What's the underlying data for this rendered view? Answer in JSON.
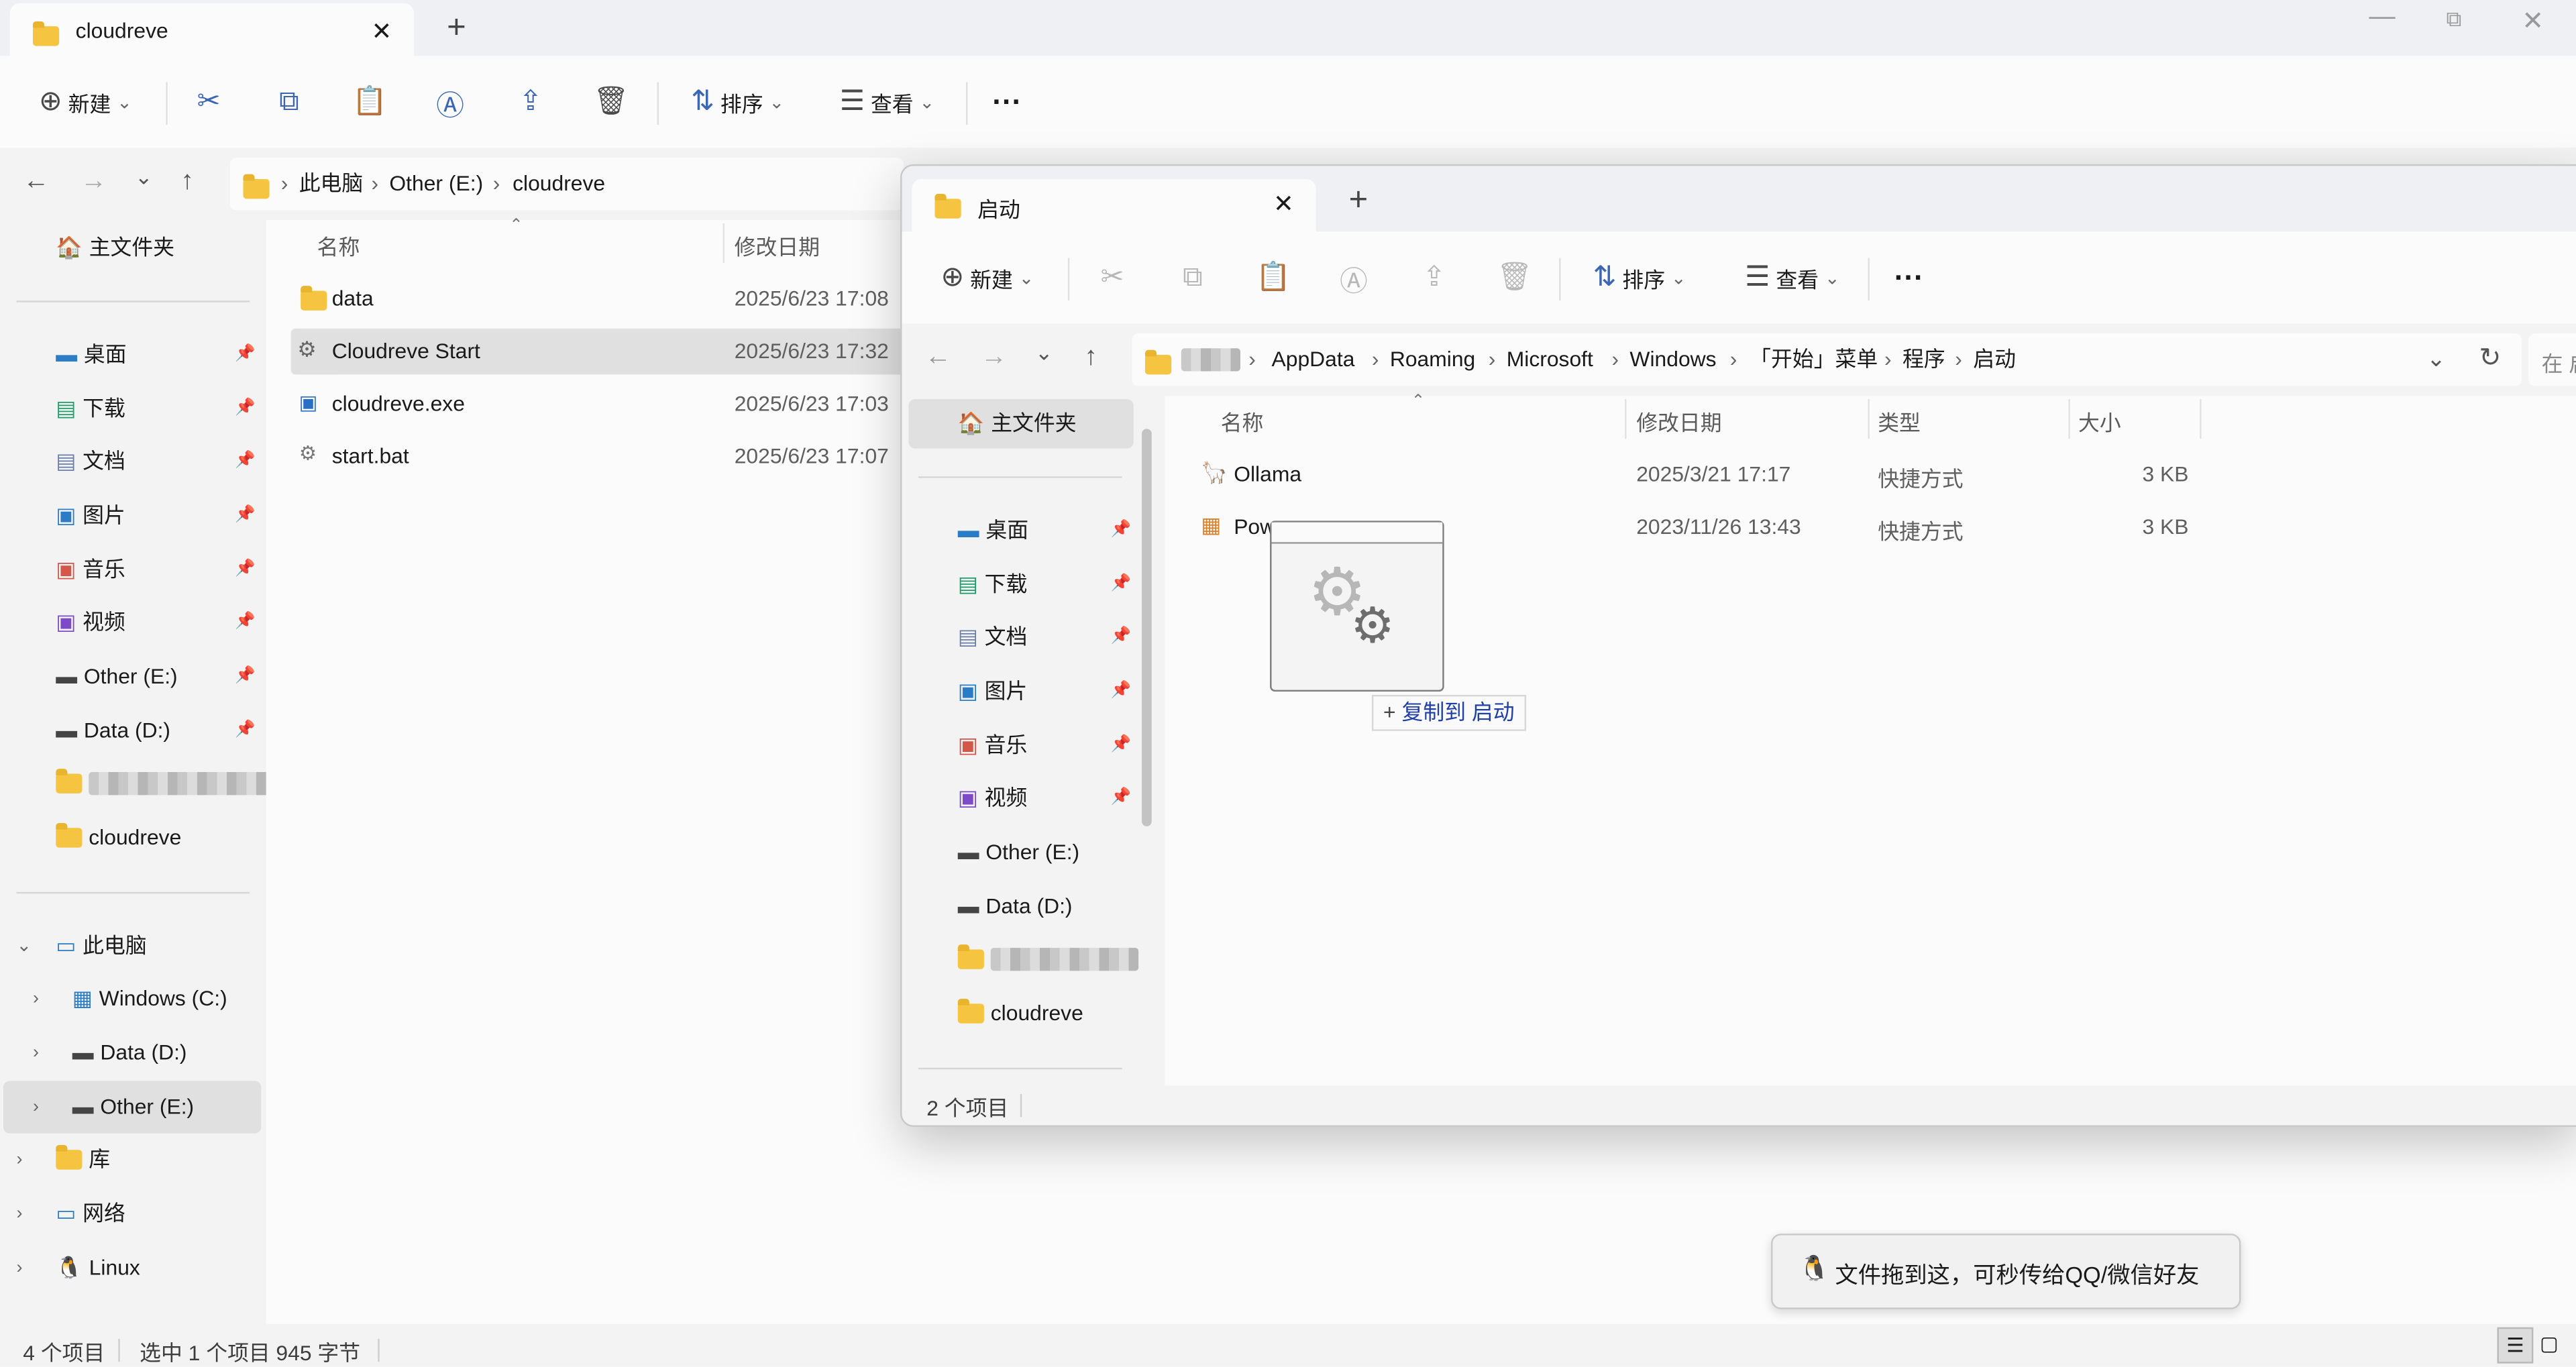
{
  "colors": {
    "accent": "#3b66b4",
    "folder": "#f5c542",
    "selected": "#e0e0e0"
  },
  "w1": {
    "tab_title": "cloudreve",
    "toolbar": {
      "new": "新建",
      "sort": "排序",
      "view": "查看"
    },
    "breadcrumb": [
      "此电脑",
      "Other (E:)",
      "cloudreve"
    ],
    "headers": {
      "name": "名称",
      "modified": "修改日期"
    },
    "files": [
      {
        "name": "data",
        "date": "2025/6/23 17:08",
        "icon": "folder-icon"
      },
      {
        "name": "Cloudreve Start",
        "date": "2025/6/23 17:32",
        "icon": "shortcut-icon"
      },
      {
        "name": "cloudreve.exe",
        "date": "2025/6/23 17:03",
        "icon": "exe-icon"
      },
      {
        "name": "start.bat",
        "date": "2025/6/23 17:07",
        "icon": "bat-icon"
      }
    ],
    "sidebar": {
      "home": "主文件夹",
      "quick": [
        "桌面",
        "下载",
        "文档",
        "图片",
        "音乐",
        "视频",
        "Other (E:)",
        "Data (D:)",
        "cloudreve"
      ],
      "pc": "此电脑",
      "drives": [
        "Windows (C:)",
        "Data (D:)",
        "Other (E:)"
      ],
      "lib": "库",
      "net": "网络",
      "linux": "Linux"
    },
    "status": {
      "count": "4 个项目",
      "selected": "选中 1 个项目",
      "size": "945 字节"
    }
  },
  "w2": {
    "tab_title": "启动",
    "toolbar": {
      "new": "新建",
      "sort": "排序",
      "view": "查看"
    },
    "breadcrumb": [
      "AppData",
      "Roaming",
      "Microsoft",
      "Windows",
      "「开始」菜单",
      "程序",
      "启动"
    ],
    "search_placeholder": "在 启",
    "headers": {
      "name": "名称",
      "modified": "修改日期",
      "type": "类型",
      "size": "大小"
    },
    "files": [
      {
        "name": "Ollama",
        "date": "2025/3/21 17:17",
        "type": "快捷方式",
        "size": "3 KB"
      },
      {
        "name": "Pow",
        "date": "2023/11/26 13:43",
        "type": "快捷方式",
        "size": "3 KB"
      }
    ],
    "sidebar": {
      "home": "主文件夹",
      "quick": [
        "桌面",
        "下载",
        "文档",
        "图片",
        "音乐",
        "视频",
        "Other (E:)",
        "Data (D:)",
        "cloudreve"
      ]
    },
    "status": {
      "count": "2 个项目"
    }
  },
  "drag": {
    "tip": "复制到 启动"
  },
  "toast": {
    "text": "文件拖到这，可秒传给QQ/微信好友"
  }
}
